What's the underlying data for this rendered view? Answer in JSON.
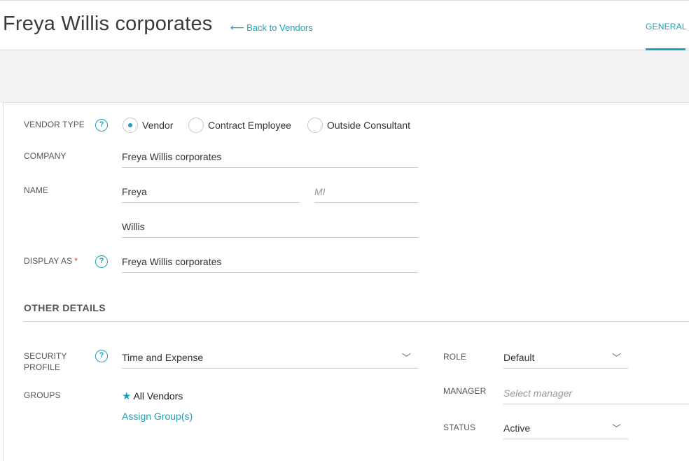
{
  "header": {
    "title": "Freya Willis corporates",
    "back_label": "Back to Vendors",
    "back_icon": "arrow-left-icon",
    "tabs": [
      {
        "label": "GENERAL",
        "active": true
      }
    ]
  },
  "form": {
    "vendor_type": {
      "label": "VENDOR TYPE",
      "options": [
        {
          "label": "Vendor",
          "selected": true
        },
        {
          "label": "Contract Employee",
          "selected": false
        },
        {
          "label": "Outside Consultant",
          "selected": false
        }
      ]
    },
    "company": {
      "label": "COMPANY",
      "value": "Freya Willis corporates"
    },
    "name": {
      "label": "NAME",
      "first": "Freya",
      "mi_placeholder": "MI",
      "last": "Willis"
    },
    "display_as": {
      "label": "DISPLAY AS",
      "required_mark": "*",
      "value": "Freya Willis corporates"
    },
    "help_glyph": "?"
  },
  "other_details": {
    "title": "OTHER DETAILS",
    "security_profile": {
      "label": "SECURITY PROFILE",
      "value": "Time and Expense"
    },
    "groups": {
      "label": "GROUPS",
      "items": [
        "All Vendors"
      ],
      "assign_label": "Assign Group(s)"
    },
    "role": {
      "label": "ROLE",
      "value": "Default"
    },
    "manager": {
      "label": "MANAGER",
      "placeholder": "Select manager"
    },
    "status": {
      "label": "STATUS",
      "value": "Active"
    }
  },
  "colors": {
    "accent": "#1aa3b8",
    "required": "#d9362b",
    "band": "#f3f3f3"
  }
}
